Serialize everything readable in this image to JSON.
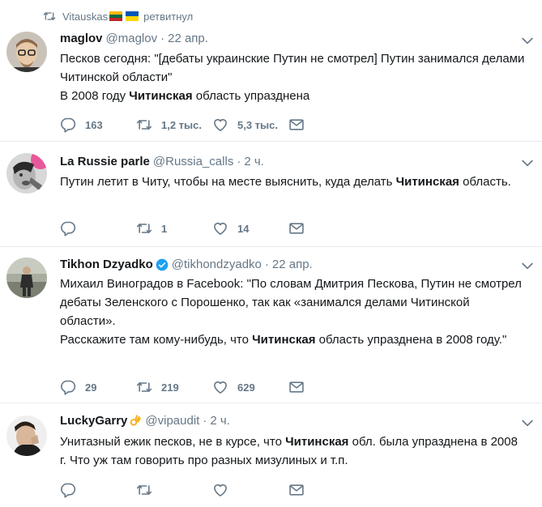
{
  "retweet_bar": {
    "user": "Vitauskas",
    "label": "ретвитнул"
  },
  "colors": {
    "muted": "#657786",
    "text": "#14171a",
    "verified": "#1da1f2",
    "border": "#e6ecf0"
  },
  "tweets": [
    {
      "name": "maglov",
      "handle": "@maglov",
      "sep": "·",
      "time": "22 апр.",
      "verified": false,
      "text_lines": [
        {
          "pre": "Песков сегодня: \"[дебаты украинские Путин не смотрел] Путин занимался делами Читинской области\"",
          "bold": "",
          "post": ""
        },
        {
          "pre": "В 2008 году ",
          "bold": "Читинская",
          "post": " область упразднена"
        }
      ],
      "replies": "163",
      "retweets": "1,2 тыс.",
      "likes": "5,3 тыс."
    },
    {
      "name": "La Russie parle",
      "handle": "@Russia_calls",
      "sep": "·",
      "time": "2 ч.",
      "verified": false,
      "text_lines": [
        {
          "pre": "Путин летит в Читу, чтобы на месте выяснить, куда делать ",
          "bold": "Читинская",
          "post": " область."
        }
      ],
      "replies": "",
      "retweets": "1",
      "likes": "14"
    },
    {
      "name": "Tikhon Dzyadko",
      "handle": "@tikhondzyadko",
      "sep": "·",
      "time": "22 апр.",
      "verified": true,
      "text_lines": [
        {
          "pre": "Михаил Виноградов в Facebook: \"По словам Дмитрия Пескова, Путин не смотрел дебаты Зеленского с Порошенко, так как «занимался делами Читинской области».",
          "bold": "",
          "post": ""
        },
        {
          "pre": "Расскажите там кому-нибудь, что ",
          "bold": "Читинская",
          "post": " область упразднена в 2008 году.\""
        }
      ],
      "replies": "29",
      "retweets": "219",
      "likes": "629"
    },
    {
      "name": "LuckyGarry",
      "handle": "@vipaudit",
      "sep": "·",
      "time": "2 ч.",
      "verified": false,
      "text_lines": [
        {
          "pre": "Унитазный ежик песков, не в курсе, что ",
          "bold": "Читинская",
          "post": " обл. была упразднена в 2008 г. Что уж там говорить про разных мизулиных и т.п."
        }
      ],
      "replies": "",
      "retweets": "",
      "likes": ""
    }
  ]
}
